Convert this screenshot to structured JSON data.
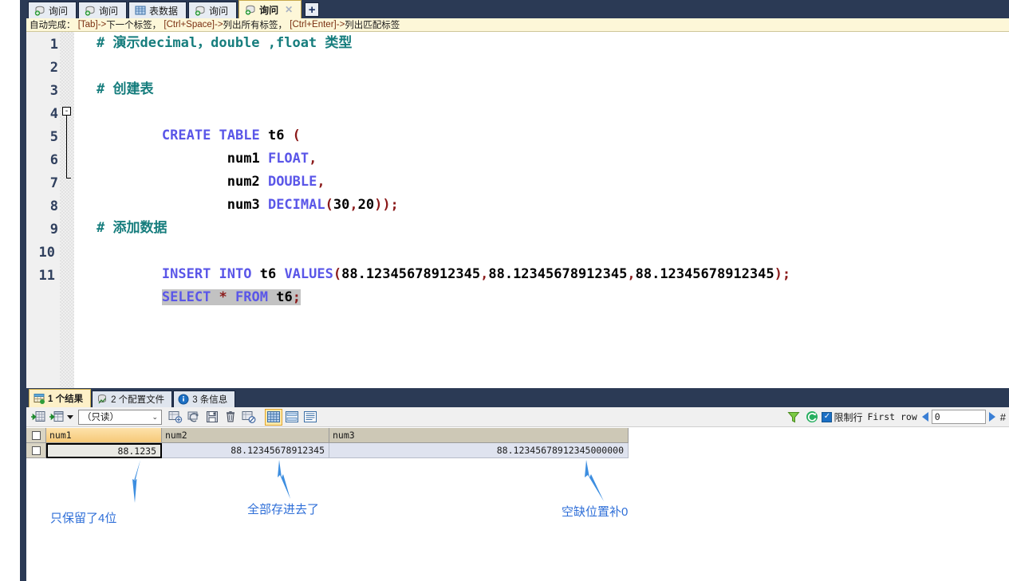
{
  "window": {
    "title": "SQL Query Editor"
  },
  "tabs": [
    {
      "label": "询问",
      "icon": "query-icon",
      "active": false,
      "closable": false
    },
    {
      "label": "询问",
      "icon": "query-icon",
      "active": false,
      "closable": false
    },
    {
      "label": "表数据",
      "icon": "table-icon",
      "active": false,
      "closable": false
    },
    {
      "label": "询问",
      "icon": "query-icon",
      "active": false,
      "closable": false
    },
    {
      "label": "询问",
      "icon": "query-icon",
      "active": true,
      "closable": true
    }
  ],
  "new_tab_button": "+",
  "hint_bar": {
    "prefix": "自动完成：",
    "items": [
      {
        "key": "[Tab]",
        "sep": "-> ",
        "desc": "下一个标签，"
      },
      {
        "key": "[Ctrl+Space]",
        "sep": "-> ",
        "desc": "列出所有标签，"
      },
      {
        "key": "[Ctrl+Enter]",
        "sep": "-> ",
        "desc": "列出匹配标签"
      }
    ]
  },
  "editor": {
    "line_numbers": [
      "1",
      "2",
      "3",
      "4",
      "5",
      "6",
      "7",
      "8",
      "9",
      "10",
      "11"
    ],
    "lines": [
      "# 演示decimal，double ,float 类型",
      "",
      "# 创建表",
      "CREATE TABLE t6 (",
      "        num1 FLOAT,",
      "        num2 DOUBLE,",
      "        num3 DECIMAL(30,20));",
      "",
      "# 添加数据",
      "INSERT INTO t6 VALUES(88.12345678912345,88.12345678912345,88.12345678912345);",
      "SELECT * FROM t6;"
    ],
    "fold_marker": "-",
    "selected_line": "SELECT * FROM t6;",
    "colors": {
      "comment": "#167d7d",
      "keyword": "#5a56e8",
      "punctuation": "#8b1a1a",
      "text": "#000000",
      "selection": "#c2c2c2"
    }
  },
  "results_tabs": [
    {
      "label": "1 个结果",
      "icon": "result-grid-icon",
      "active": true
    },
    {
      "label": "2 个配置文件",
      "icon": "profile-icon",
      "active": false
    },
    {
      "label": "3 条信息",
      "icon": "info-icon",
      "active": false
    }
  ],
  "results_toolbar": {
    "buttons": [
      {
        "name": "add-record-icon",
        "glyph": "grid-plus"
      },
      {
        "name": "add-record-dropdown-icon",
        "glyph": "grid-plus-alt"
      }
    ],
    "mode_select": {
      "value": "（只读）",
      "chevron": "⌄"
    },
    "action_buttons": [
      {
        "name": "insert-record-icon"
      },
      {
        "name": "refresh-record-icon"
      },
      {
        "name": "save-record-icon"
      },
      {
        "name": "delete-record-icon"
      },
      {
        "name": "cancel-record-icon"
      }
    ],
    "view_buttons": [
      {
        "name": "grid-view-icon",
        "active": true
      },
      {
        "name": "form-view-icon",
        "active": false
      },
      {
        "name": "text-view-icon",
        "active": false
      }
    ],
    "filter_icon": "funnel-icon",
    "refresh_icon": "refresh-icon",
    "limit_rows": {
      "checked": true,
      "label": "限制行"
    },
    "first_row_label": "First row",
    "first_row_value": "0",
    "hash_label": "#"
  },
  "grid": {
    "columns": [
      "num1",
      "num2",
      "num3"
    ],
    "rows": [
      [
        "88.1235",
        "88.12345678912345",
        "88.12345678912345000000"
      ]
    ],
    "active_column": "num1",
    "focused_cell": {
      "row": 0,
      "col": 0
    }
  },
  "annotations": [
    {
      "text": "只保留了4位",
      "color": "#2f6fd8"
    },
    {
      "text": "全部存进去了",
      "color": "#2f6fd8"
    },
    {
      "text": "空缺位置补0",
      "color": "#2f6fd8"
    }
  ]
}
